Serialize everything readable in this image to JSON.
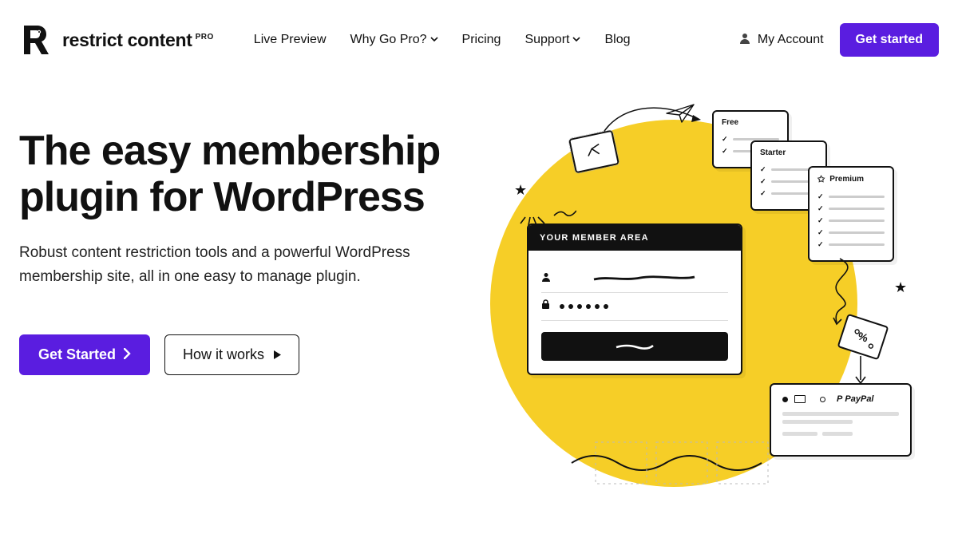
{
  "brand": {
    "name": "restrict content",
    "suffix": "PRO"
  },
  "nav": {
    "items": [
      {
        "label": "Live Preview",
        "has_dropdown": false
      },
      {
        "label": "Why Go Pro?",
        "has_dropdown": true
      },
      {
        "label": "Pricing",
        "has_dropdown": false
      },
      {
        "label": "Support",
        "has_dropdown": true
      },
      {
        "label": "Blog",
        "has_dropdown": false
      }
    ]
  },
  "account": {
    "label": "My Account"
  },
  "header_cta": {
    "label": "Get started"
  },
  "hero": {
    "title": "The easy membership plugin for WordPress",
    "subtitle": "Robust content restriction tools and a powerful WordPress membership site, all in one easy to manage plugin.",
    "primary_cta": "Get Started",
    "secondary_cta": "How it works"
  },
  "illustration": {
    "member_card_title": "YOUR MEMBER AREA",
    "tiers": {
      "free": "Free",
      "starter": "Starter",
      "premium": "Premium"
    },
    "payment": {
      "paypal": "PayPal"
    },
    "coupon": "%"
  }
}
